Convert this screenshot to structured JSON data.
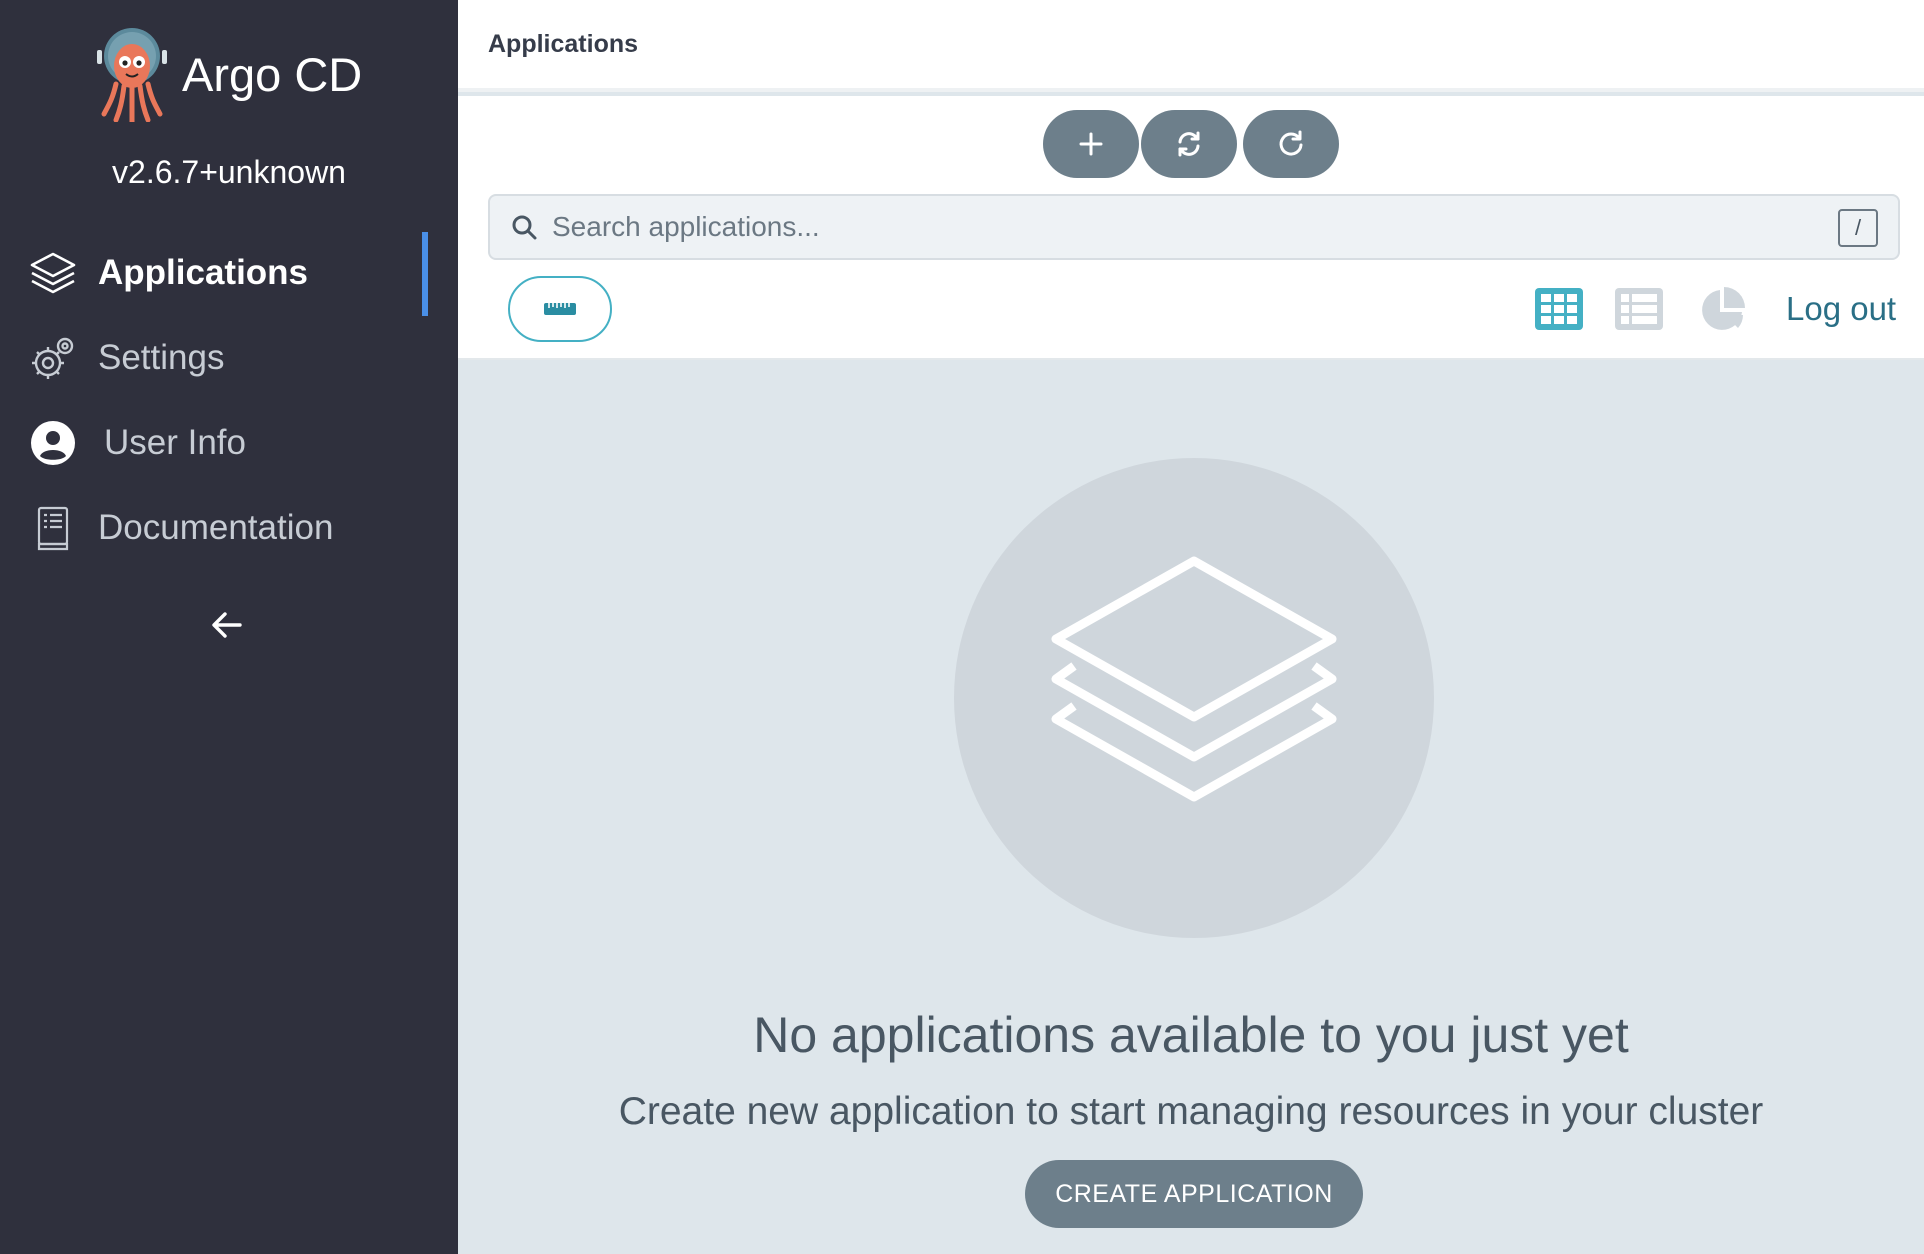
{
  "app": {
    "name": "Argo CD",
    "version": "v2.6.7+unknown"
  },
  "sidebar": {
    "items": [
      {
        "label": "Applications",
        "icon": "layers-icon",
        "active": true
      },
      {
        "label": "Settings",
        "icon": "gears-icon",
        "active": false
      },
      {
        "label": "User Info",
        "icon": "user-circle-icon",
        "active": false
      },
      {
        "label": "Documentation",
        "icon": "book-icon",
        "active": false
      }
    ],
    "collapse_icon": "arrow-left-icon"
  },
  "header": {
    "title": "Applications"
  },
  "toolbar": {
    "new_app_icon": "plus-icon",
    "sync_apps_icon": "sync-icon",
    "refresh_apps_icon": "refresh-icon",
    "search_placeholder": "Search applications...",
    "search_value": "",
    "search_shortcut": "/",
    "filter_icon": "ruler-icon",
    "view_tiles_icon": "th-icon",
    "view_list_icon": "list-icon",
    "view_summary_icon": "pie-chart-icon",
    "logout_label": "Log out",
    "active_view": "tiles"
  },
  "empty_state": {
    "icon": "layers-icon",
    "title": "No applications available to you just yet",
    "subtitle": "Create new application to start managing resources in your cluster",
    "button_label": "CREATE APPLICATION"
  },
  "colors": {
    "sidebar_bg": "#2f303d",
    "accent_blue": "#4a8fe7",
    "teal": "#44b0c4",
    "button_gray": "#6d7f8b",
    "content_bg": "#dee6eb"
  }
}
